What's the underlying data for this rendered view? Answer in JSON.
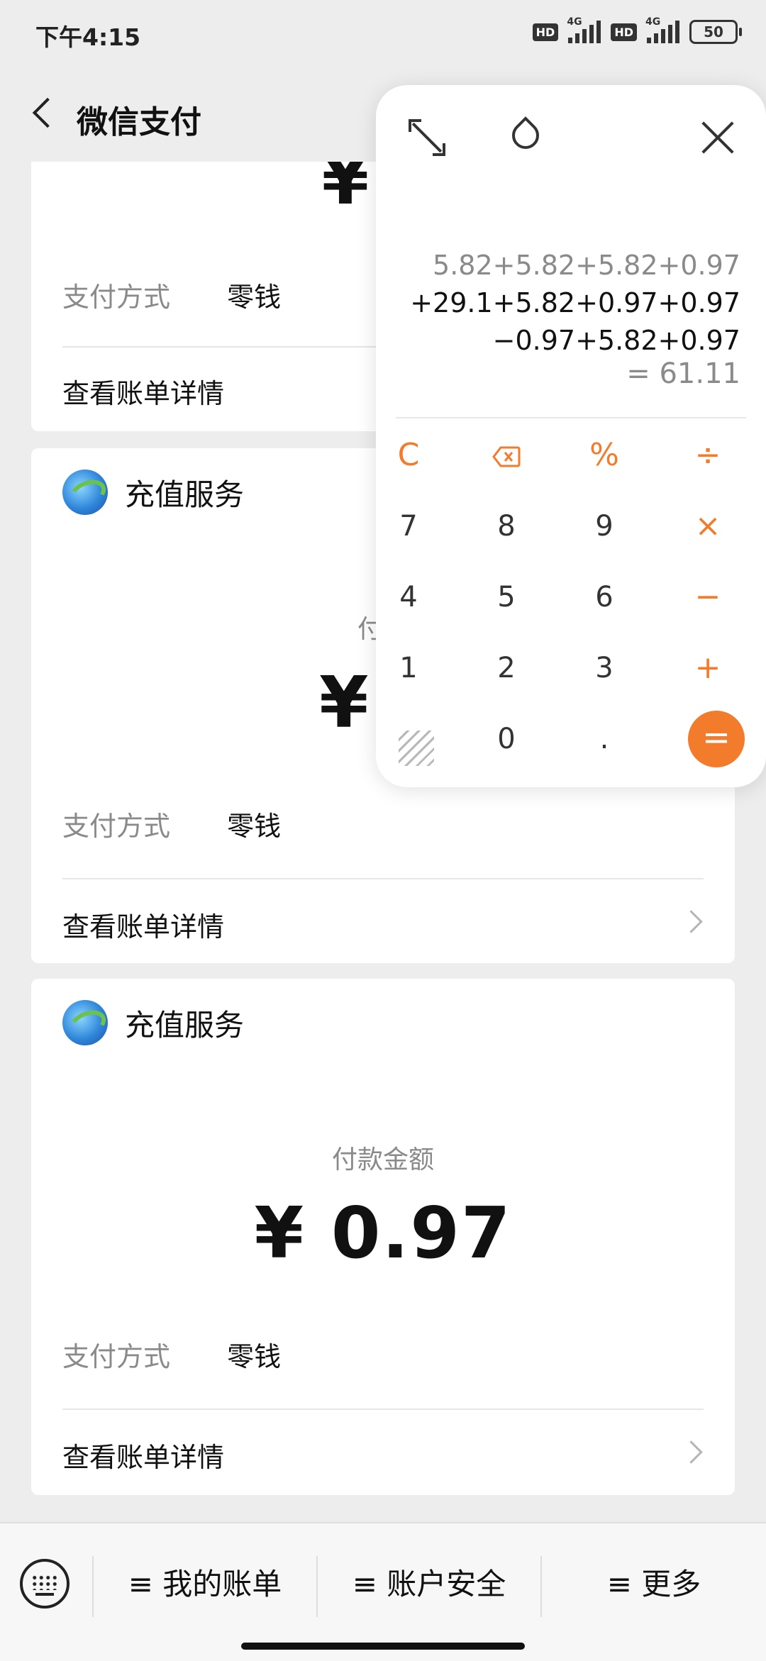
{
  "status_bar": {
    "time": "下午4:15",
    "hd1": "HD",
    "hd2": "HD",
    "net1": "4G",
    "net2": "4G",
    "battery": "50"
  },
  "nav": {
    "back_icon": "chevron-left-icon",
    "title": "微信支付"
  },
  "cards": [
    {
      "amount_visible": "¥ 0",
      "payment_method_label": "支付方式",
      "payment_method_value": "零钱",
      "detail_label": "查看账单详情"
    },
    {
      "service_name": "充值服务",
      "amount_label_visible": "付款",
      "amount_visible": "¥ 5",
      "payment_method_label": "支付方式",
      "payment_method_value": "零钱",
      "detail_label": "查看账单详情"
    },
    {
      "service_name": "充值服务",
      "amount_label": "付款金额",
      "amount": "¥ 0.97",
      "payment_method_label": "支付方式",
      "payment_method_value": "零钱",
      "detail_label": "查看账单详情"
    }
  ],
  "calculator": {
    "expression_lines": [
      "5.82+5.82+5.82+0.97",
      "+29.1+5.82+0.97+0.97",
      "−0.97+5.82+0.97"
    ],
    "result": "= 61.11",
    "keys": {
      "clear": "C",
      "percent": "%",
      "divide": "÷",
      "multiply": "×",
      "minus": "−",
      "plus": "+",
      "equals": "=",
      "dot": ".",
      "d0": "0",
      "d1": "1",
      "d2": "2",
      "d3": "3",
      "d4": "4",
      "d5": "5",
      "d6": "6",
      "d7": "7",
      "d8": "8",
      "d9": "9"
    },
    "accent_color": "#f37b2c"
  },
  "bottom_bar": {
    "my_bill": "≡ 我的账单",
    "account_security": "≡ 账户安全",
    "more": "≡ 更多"
  }
}
